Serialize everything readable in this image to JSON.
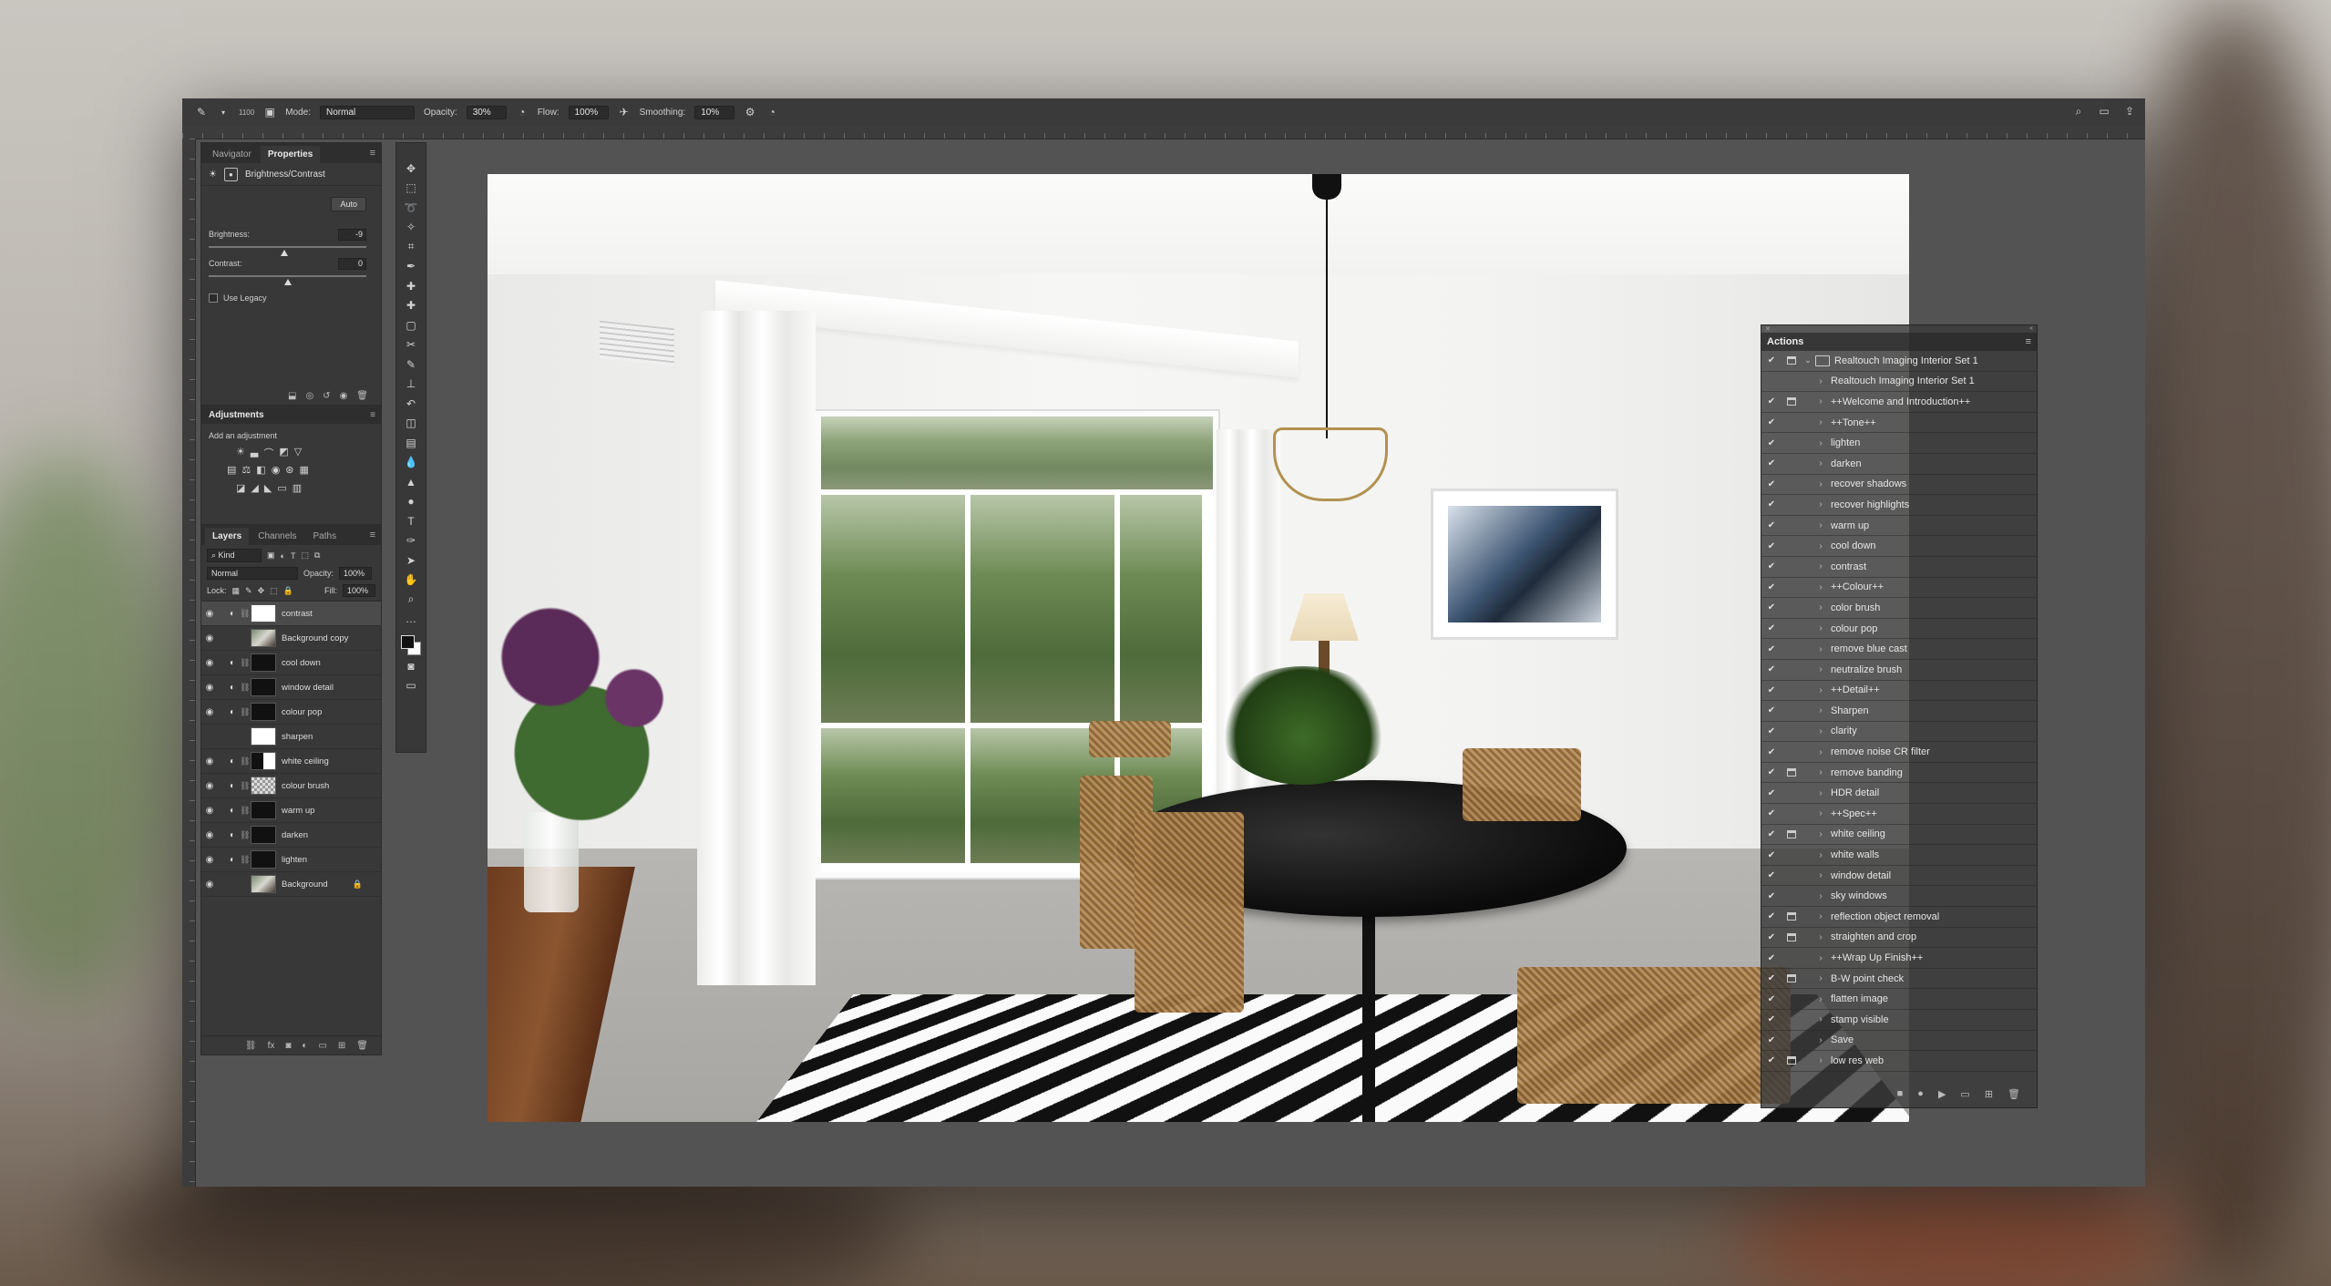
{
  "colors": {
    "panel": "#383838",
    "workspace": "#535353",
    "accent": "#dcdcdc"
  },
  "optbar": {
    "brush_size": "1100",
    "mode_label": "Mode:",
    "mode_value": "Normal",
    "opacity_label": "Opacity:",
    "opacity_value": "30%",
    "flow_label": "Flow:",
    "flow_value": "100%",
    "smoothing_label": "Smoothing:",
    "smoothing_value": "10%"
  },
  "ruler": {
    "marks": [
      "",
      "2",
      "4",
      "6",
      "8",
      "10",
      "12",
      "14",
      "16",
      "18",
      "20",
      "22",
      "24",
      "26",
      "28",
      "30",
      "32",
      "34",
      "36",
      "38",
      "40",
      "42",
      "44",
      "46",
      "48",
      "50",
      "52",
      "54",
      "56"
    ]
  },
  "properties_panel": {
    "tabs": [
      "Navigator",
      "Properties"
    ],
    "title": "Brightness/Contrast",
    "auto_label": "Auto",
    "brightness_label": "Brightness:",
    "brightness_value": "-9",
    "contrast_label": "Contrast:",
    "contrast_value": "0",
    "legacy_label": "Use Legacy"
  },
  "adjustments_panel": {
    "title": "Adjustments",
    "subtitle": "Add an adjustment"
  },
  "layers_panel": {
    "tabs": [
      "Layers",
      "Channels",
      "Paths"
    ],
    "kind_label": "Kind",
    "blend_mode": "Normal",
    "opacity_label": "Opacity:",
    "opacity_value": "100%",
    "lock_label": "Lock:",
    "fill_label": "Fill:",
    "fill_value": "100%",
    "layers": [
      {
        "name": "contrast",
        "thumb": "white",
        "adj": true,
        "selected": true,
        "visible": true
      },
      {
        "name": "Background copy",
        "thumb": "photo",
        "adj": false,
        "selected": false,
        "visible": true
      },
      {
        "name": "cool down",
        "thumb": "dark",
        "adj": true,
        "selected": false,
        "visible": true
      },
      {
        "name": "window detail",
        "thumb": "dark",
        "adj": true,
        "selected": false,
        "visible": true
      },
      {
        "name": "colour pop",
        "thumb": "dark",
        "adj": true,
        "selected": false,
        "visible": true
      },
      {
        "name": "sharpen",
        "thumb": "white",
        "adj": false,
        "selected": false,
        "visible": false
      },
      {
        "name": "white ceiling",
        "thumb": "mixed",
        "adj": true,
        "selected": false,
        "visible": true
      },
      {
        "name": "colour brush",
        "thumb": "check",
        "adj": true,
        "selected": false,
        "visible": true
      },
      {
        "name": "warm up",
        "thumb": "dark",
        "adj": true,
        "selected": false,
        "visible": true
      },
      {
        "name": "darken",
        "thumb": "dark",
        "adj": true,
        "selected": false,
        "visible": true
      },
      {
        "name": "lighten",
        "thumb": "dark",
        "adj": true,
        "selected": false,
        "visible": true
      },
      {
        "name": "Background",
        "thumb": "photo",
        "adj": false,
        "selected": false,
        "visible": true,
        "locked": true
      }
    ]
  },
  "actions_panel": {
    "title": "Actions",
    "set_name": "Realtouch Imaging Interior Set 1",
    "items": [
      {
        "label": "Realtouch Imaging Interior Set 1",
        "check": false,
        "dialog": false
      },
      {
        "label": "++Welcome and Introduction++",
        "check": true,
        "dialog": true
      },
      {
        "label": "++Tone++",
        "check": true,
        "dialog": false
      },
      {
        "label": "lighten",
        "check": true,
        "dialog": false
      },
      {
        "label": "darken",
        "check": true,
        "dialog": false
      },
      {
        "label": "recover shadows",
        "check": true,
        "dialog": false
      },
      {
        "label": "recover highlights",
        "check": true,
        "dialog": false
      },
      {
        "label": "warm up",
        "check": true,
        "dialog": false
      },
      {
        "label": "cool down",
        "check": true,
        "dialog": false
      },
      {
        "label": "contrast",
        "check": true,
        "dialog": false
      },
      {
        "label": "++Colour++",
        "check": true,
        "dialog": false
      },
      {
        "label": "color brush",
        "check": true,
        "dialog": false
      },
      {
        "label": "colour pop",
        "check": true,
        "dialog": false
      },
      {
        "label": "remove blue cast",
        "check": true,
        "dialog": false
      },
      {
        "label": "neutralize brush",
        "check": true,
        "dialog": false
      },
      {
        "label": "++Detail++",
        "check": true,
        "dialog": false
      },
      {
        "label": "Sharpen",
        "check": true,
        "dialog": false
      },
      {
        "label": "clarity",
        "check": true,
        "dialog": false
      },
      {
        "label": "remove noise CR filter",
        "check": true,
        "dialog": false
      },
      {
        "label": "remove banding",
        "check": true,
        "dialog": true
      },
      {
        "label": "HDR detail",
        "check": true,
        "dialog": false
      },
      {
        "label": "++Spec++",
        "check": true,
        "dialog": false
      },
      {
        "label": "white ceiling",
        "check": true,
        "dialog": true
      },
      {
        "label": "white walls",
        "check": true,
        "dialog": false
      },
      {
        "label": "window detail",
        "check": true,
        "dialog": false
      },
      {
        "label": "sky windows",
        "check": true,
        "dialog": false
      },
      {
        "label": "reflection object removal",
        "check": true,
        "dialog": true
      },
      {
        "label": "straighten and crop",
        "check": true,
        "dialog": true
      },
      {
        "label": "++Wrap Up Finish++",
        "check": true,
        "dialog": false
      },
      {
        "label": "B-W point check",
        "check": true,
        "dialog": true
      },
      {
        "label": "flatten image",
        "check": true,
        "dialog": false
      },
      {
        "label": "stamp visible",
        "check": true,
        "dialog": false
      },
      {
        "label": "Save",
        "check": true,
        "dialog": false
      },
      {
        "label": "low res web",
        "check": true,
        "dialog": true
      }
    ]
  }
}
